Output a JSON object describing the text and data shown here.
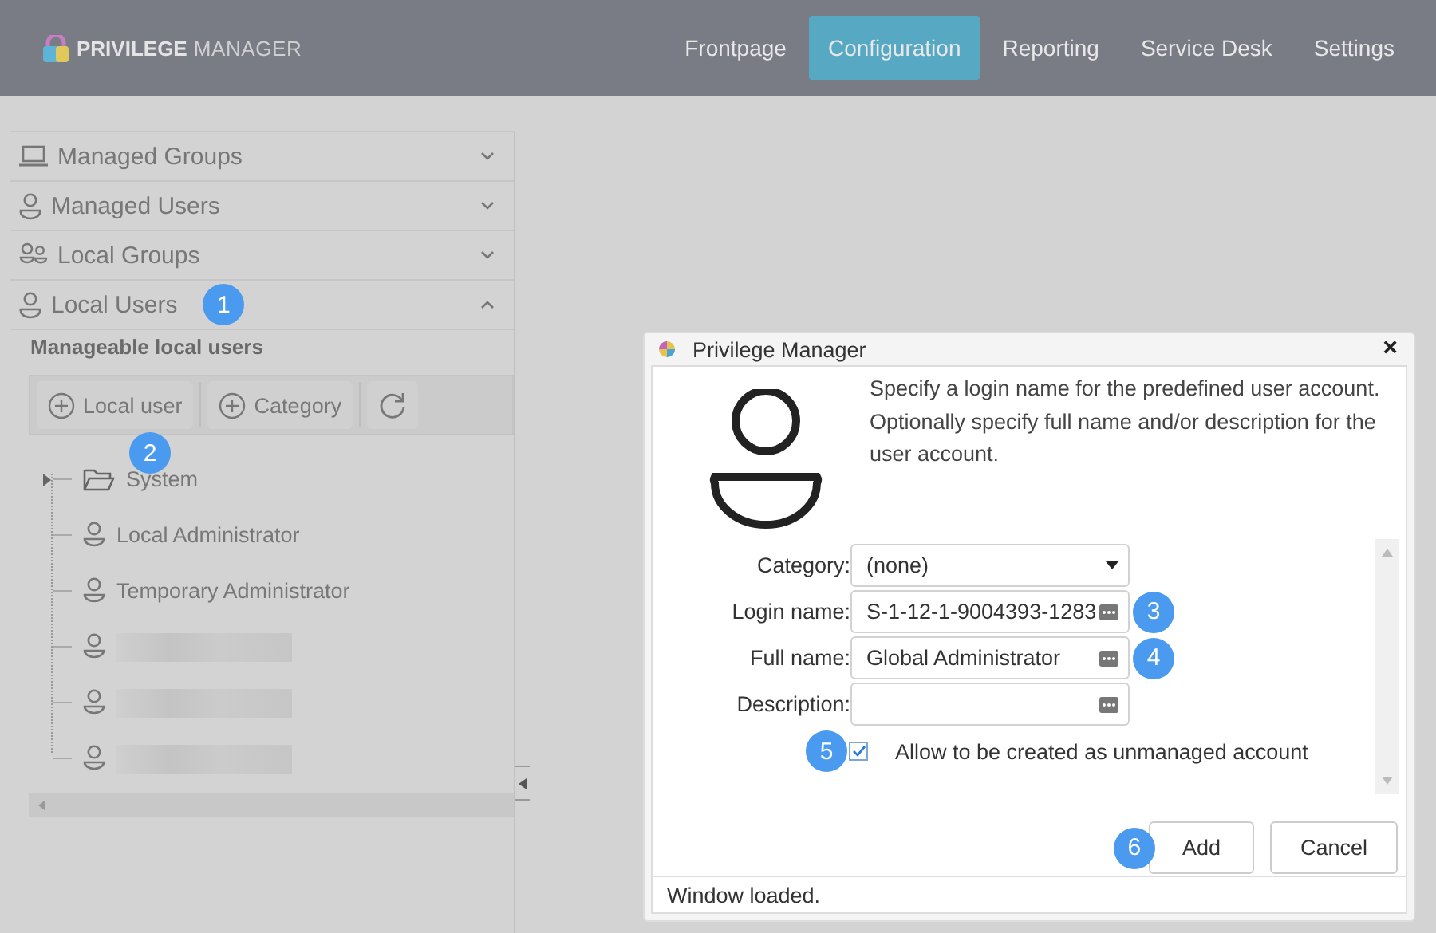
{
  "header": {
    "brand_bold": "PRIVILEGE",
    "brand_light": "MANAGER",
    "tabs": [
      {
        "label": "Frontpage",
        "selected": false
      },
      {
        "label": "Configuration",
        "selected": true
      },
      {
        "label": "Reporting",
        "selected": false
      },
      {
        "label": "Service Desk",
        "selected": false
      },
      {
        "label": "Settings",
        "selected": false
      }
    ]
  },
  "sidebar": {
    "sections": [
      {
        "label": "Managed Groups",
        "kind": "laptop",
        "expanded": false
      },
      {
        "label": "Managed Users",
        "kind": "user",
        "expanded": false
      },
      {
        "label": "Local Groups",
        "kind": "users",
        "expanded": false
      },
      {
        "label": "Local Users",
        "kind": "user",
        "expanded": true,
        "callout": "1"
      }
    ],
    "heading": "Manageable local users",
    "toolbar": [
      {
        "kind": "add",
        "label": "Local user",
        "callout": "2"
      },
      {
        "kind": "add",
        "label": "Category"
      },
      {
        "kind": "refresh"
      }
    ],
    "tree": [
      {
        "kind": "folder",
        "label": "System",
        "expanded": false
      },
      {
        "kind": "user",
        "label": "Local Administrator"
      },
      {
        "kind": "user",
        "label": "Temporary Administrator"
      },
      {
        "kind": "redacted"
      },
      {
        "kind": "redacted"
      },
      {
        "kind": "redacted"
      }
    ]
  },
  "dialog": {
    "title": "Privilege Manager",
    "close": "×",
    "message": "Specify a login name for the predefined user account. Optionally specify full name and/or description for the user account.",
    "fields": [
      {
        "kind": "select",
        "label": "Category:",
        "value": "(none)"
      },
      {
        "kind": "text",
        "label": "Login name:",
        "value": "S-1-12-1-9004393-1283",
        "callout": "3"
      },
      {
        "kind": "text",
        "label": "Full name:",
        "value": "Global Administrator",
        "callout": "4"
      },
      {
        "kind": "text",
        "label": "Description:"
      }
    ],
    "checkbox": {
      "label": "Allow to be created as unmanaged account",
      "checked": true,
      "callout": "5"
    },
    "buttons": [
      {
        "label": "Add",
        "callout": "6"
      },
      {
        "label": "Cancel"
      }
    ],
    "status": "Window loaded."
  }
}
